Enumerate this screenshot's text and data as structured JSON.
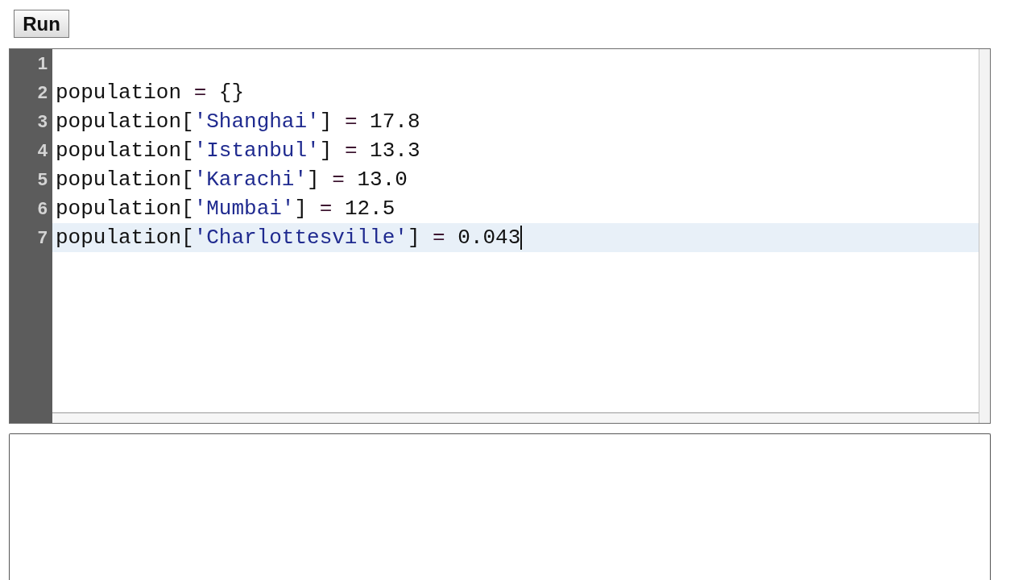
{
  "toolbar": {
    "run_button": {
      "label": "Run"
    }
  },
  "editor": {
    "lines": [
      {
        "number": "1",
        "active": false,
        "cursor": false
      },
      {
        "number": "2",
        "active": false,
        "cursor": false,
        "tokens": [
          {
            "kind": "name",
            "text": "population"
          },
          {
            "kind": "operator",
            "text": " = "
          },
          {
            "kind": "punct",
            "text": "{}"
          }
        ]
      },
      {
        "number": "3",
        "active": false,
        "cursor": false,
        "tokens": [
          {
            "kind": "name",
            "text": "population"
          },
          {
            "kind": "punct",
            "text": "["
          },
          {
            "kind": "string",
            "text": "'Shanghai'"
          },
          {
            "kind": "punct",
            "text": "]"
          },
          {
            "kind": "operator",
            "text": " = "
          },
          {
            "kind": "number",
            "text": "17.8"
          }
        ]
      },
      {
        "number": "4",
        "active": false,
        "cursor": false,
        "tokens": [
          {
            "kind": "name",
            "text": "population"
          },
          {
            "kind": "punct",
            "text": "["
          },
          {
            "kind": "string",
            "text": "'Istanbul'"
          },
          {
            "kind": "punct",
            "text": "]"
          },
          {
            "kind": "operator",
            "text": " = "
          },
          {
            "kind": "number",
            "text": "13.3"
          }
        ]
      },
      {
        "number": "5",
        "active": false,
        "cursor": false,
        "tokens": [
          {
            "kind": "name",
            "text": "population"
          },
          {
            "kind": "punct",
            "text": "["
          },
          {
            "kind": "string",
            "text": "'Karachi'"
          },
          {
            "kind": "punct",
            "text": "]"
          },
          {
            "kind": "operator",
            "text": " = "
          },
          {
            "kind": "number",
            "text": "13.0"
          }
        ]
      },
      {
        "number": "6",
        "active": false,
        "cursor": false,
        "tokens": [
          {
            "kind": "name",
            "text": "population"
          },
          {
            "kind": "punct",
            "text": "["
          },
          {
            "kind": "string",
            "text": "'Mumbai'"
          },
          {
            "kind": "punct",
            "text": "]"
          },
          {
            "kind": "operator",
            "text": " = "
          },
          {
            "kind": "number",
            "text": "12.5"
          }
        ]
      },
      {
        "number": "7",
        "active": true,
        "cursor": true,
        "tokens": [
          {
            "kind": "name",
            "text": "population"
          },
          {
            "kind": "punct",
            "text": "["
          },
          {
            "kind": "string",
            "text": "'Charlottesville'"
          },
          {
            "kind": "punct",
            "text": "]"
          },
          {
            "kind": "operator",
            "text": " = "
          },
          {
            "kind": "number",
            "text": "0.043"
          }
        ]
      }
    ]
  }
}
